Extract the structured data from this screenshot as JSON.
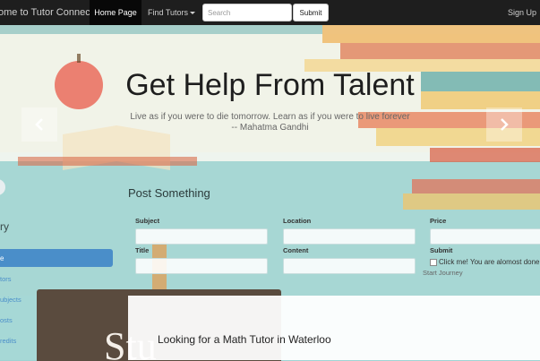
{
  "nav": {
    "brand": "ome to Tutor Connect",
    "home_label": "Home Page",
    "find_label": "Find Tutors",
    "search_placeholder": "Search",
    "submit_label": "Submit",
    "signup_label": "Sign Up"
  },
  "hero": {
    "title": "Get Help From Talent",
    "quote_line1": "Live as if you were to die tomorrow. Learn as if you were to live forever",
    "quote_line2": "-- Mahatma Gandhi",
    "prev_icon": "chevron-left-icon",
    "next_icon": "chevron-right-icon"
  },
  "post": {
    "heading": "Post Something",
    "subject_label": "Subject",
    "location_label": "Location",
    "price_label": "Price",
    "title_label": "Title",
    "content_label": "Content",
    "submit_label": "Submit",
    "checkbox_label": "Click me! You are alomost done",
    "journey_label": "Start Journey"
  },
  "sidebar": {
    "heading_partial": "ry",
    "items": [
      "e",
      "tors",
      "ubjects",
      "osts",
      "redits"
    ]
  },
  "study_text": "Stu",
  "card": {
    "title": "Looking for a Math Tutor in Waterloo"
  },
  "colors": {
    "navbar": "#1e1e1e",
    "background": "#9fd3d3",
    "active": "#4a8ec9"
  }
}
